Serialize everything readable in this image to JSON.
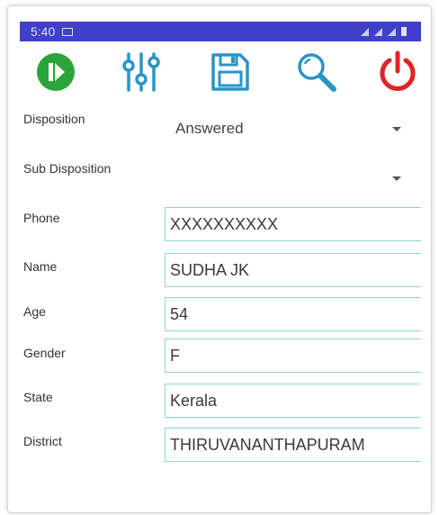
{
  "status_bar": {
    "time": "5:40"
  },
  "toolbar": {
    "icons": [
      "next-icon",
      "sliders-icon",
      "save-icon",
      "search-icon",
      "power-icon"
    ],
    "colors": {
      "next": "#2aa53a",
      "sliders": "#2a93c9",
      "save": "#2a93c9",
      "search": "#2a93c9",
      "power": "#e02323"
    }
  },
  "form": {
    "disposition": {
      "label": "Disposition",
      "value": "Answered"
    },
    "sub_disposition": {
      "label": "Sub Disposition",
      "value": ""
    },
    "phone": {
      "label": "Phone",
      "value": "XXXXXXXXXX"
    },
    "name": {
      "label": "Name",
      "value": "SUDHA JK"
    },
    "age": {
      "label": "Age",
      "value": "54"
    },
    "gender": {
      "label": "Gender",
      "value": "F"
    },
    "state": {
      "label": "State",
      "value": "Kerala"
    },
    "district": {
      "label": "District",
      "value": "THIRUVANANTHAPURAM"
    }
  },
  "colors": {
    "status_bar": "#3f3fc8",
    "field_border": "#8ed4d8"
  }
}
